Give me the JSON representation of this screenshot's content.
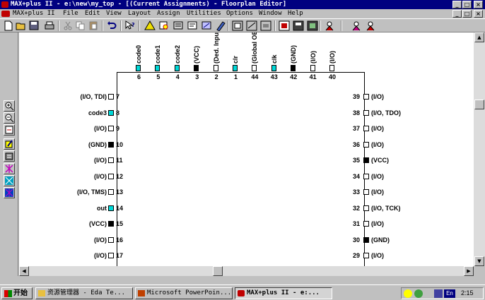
{
  "window": {
    "title": "MAX+plus II - e:\\new\\my_top - [(Current Assignments) - Floorplan Editor]",
    "controls": [
      "_",
      "□",
      "×"
    ]
  },
  "menu": {
    "items": [
      "MAX+plus II",
      "File",
      "Edit",
      "View",
      "Layout",
      "Assign",
      "Utilities",
      "Options",
      "Window",
      "Help"
    ],
    "doc_controls": [
      "_",
      "□",
      "×"
    ]
  },
  "toolbar": {
    "icons": [
      "new-icon",
      "open-icon",
      "save-icon",
      "print-icon",
      "cut-icon",
      "copy-icon",
      "paste-icon",
      "undo-icon",
      "help-pointer-icon",
      "hierarchy-up-icon",
      "find-icon",
      "find-node-icon",
      "assign-icon",
      "back-annotate-icon",
      "compiler-icon",
      "simulator-icon",
      "timing-analyzer-icon",
      "programmer-icon",
      "compile-icon",
      "save-check-icon",
      "open-programmer-icon",
      "floorplan-icon",
      "toggle-view-icon"
    ]
  },
  "palette": {
    "icons": [
      "zoom-in-icon",
      "zoom-out-icon",
      "fit-window-icon",
      "assign-node-icon",
      "clear-assignment-icon",
      "show-routing-icon",
      "pin-icon",
      "lab-icon"
    ]
  },
  "chip": {
    "top_pins": [
      {
        "number": "6",
        "name": "code0",
        "type": "cyan"
      },
      {
        "number": "5",
        "name": "code1",
        "type": "cyan"
      },
      {
        "number": "4",
        "name": "code2",
        "type": "cyan"
      },
      {
        "number": "3",
        "name": "(VCC)",
        "type": "black"
      },
      {
        "number": "2",
        "name": "(Ded. Input)",
        "type": "white"
      },
      {
        "number": "1",
        "name": "clr",
        "type": "cyan"
      },
      {
        "number": "44",
        "name": "(Global OE)",
        "type": "white"
      },
      {
        "number": "43",
        "name": "clk",
        "type": "cyan"
      },
      {
        "number": "42",
        "name": "(GND)",
        "type": "black"
      },
      {
        "number": "41",
        "name": "(I/O)",
        "type": "white"
      },
      {
        "number": "40",
        "name": "(I/O)",
        "type": "white"
      }
    ],
    "left_pins": [
      {
        "number": "7",
        "name": "(I/O, TDI)",
        "type": "white"
      },
      {
        "number": "8",
        "name": "code3",
        "type": "cyan"
      },
      {
        "number": "9",
        "name": "(I/O)",
        "type": "white"
      },
      {
        "number": "10",
        "name": "(GND)",
        "type": "black"
      },
      {
        "number": "11",
        "name": "(I/O)",
        "type": "white"
      },
      {
        "number": "12",
        "name": "(I/O)",
        "type": "white"
      },
      {
        "number": "13",
        "name": "(I/O, TMS)",
        "type": "white"
      },
      {
        "number": "14",
        "name": "out",
        "type": "cyan"
      },
      {
        "number": "15",
        "name": "(VCC)",
        "type": "black"
      },
      {
        "number": "16",
        "name": "(I/O)",
        "type": "white"
      },
      {
        "number": "17",
        "name": "(I/O)",
        "type": "white"
      }
    ],
    "right_pins": [
      {
        "number": "39",
        "name": "(I/O)",
        "type": "white"
      },
      {
        "number": "38",
        "name": "(I/O, TDO)",
        "type": "white"
      },
      {
        "number": "37",
        "name": "(I/O)",
        "type": "white"
      },
      {
        "number": "36",
        "name": "(I/O)",
        "type": "white"
      },
      {
        "number": "35",
        "name": "(VCC)",
        "type": "black"
      },
      {
        "number": "34",
        "name": "(I/O)",
        "type": "white"
      },
      {
        "number": "33",
        "name": "(I/O)",
        "type": "white"
      },
      {
        "number": "32",
        "name": "(I/O, TCK)",
        "type": "white"
      },
      {
        "number": "31",
        "name": "(I/O)",
        "type": "white"
      },
      {
        "number": "30",
        "name": "(GND)",
        "type": "black"
      },
      {
        "number": "29",
        "name": "(I/O)",
        "type": "white"
      }
    ]
  },
  "taskbar": {
    "start_label": "开始",
    "tasks": [
      {
        "label": "资源管理器 - Eda Te...",
        "active": false
      },
      {
        "label": "Microsoft PowerPoin...",
        "active": false
      },
      {
        "label": "MAX+plus II - e:...",
        "active": true
      }
    ],
    "tray": {
      "lang": "En",
      "time": "2:15"
    }
  },
  "colors": {
    "cyan_pad": "#00d8d8",
    "title_bar": "#000080",
    "face": "#c0c0c0"
  }
}
